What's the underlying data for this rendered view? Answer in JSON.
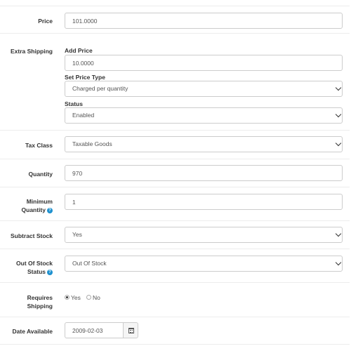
{
  "fields": {
    "price": {
      "label": "Price",
      "value": "101.0000"
    },
    "extra_shipping": {
      "label": "Extra Shipping",
      "add_price_label": "Add Price",
      "add_price_value": "10.0000",
      "price_type_label": "Set Price Type",
      "price_type_value": "Charged per quantity",
      "status_label": "Status",
      "status_value": "Enabled"
    },
    "tax_class": {
      "label": "Tax Class",
      "value": "Taxable Goods"
    },
    "quantity": {
      "label": "Quantity",
      "value": "970"
    },
    "minimum_quantity": {
      "label_line1": "Minimum",
      "label_line2": "Quantity",
      "value": "1"
    },
    "subtract_stock": {
      "label": "Subtract Stock",
      "value": "Yes"
    },
    "out_of_stock_status": {
      "label_line1": "Out Of Stock",
      "label_line2": "Status",
      "value": "Out Of Stock"
    },
    "requires_shipping": {
      "label_line1": "Requires",
      "label_line2": "Shipping",
      "option_yes": "Yes",
      "option_no": "No",
      "selected": "Yes"
    },
    "date_available": {
      "label": "Date Available",
      "value": "2009-02-03"
    }
  },
  "help_icon": "?",
  "colors": {
    "help": "#1e91cf",
    "border": "#cccccc",
    "divider": "#ededed"
  }
}
